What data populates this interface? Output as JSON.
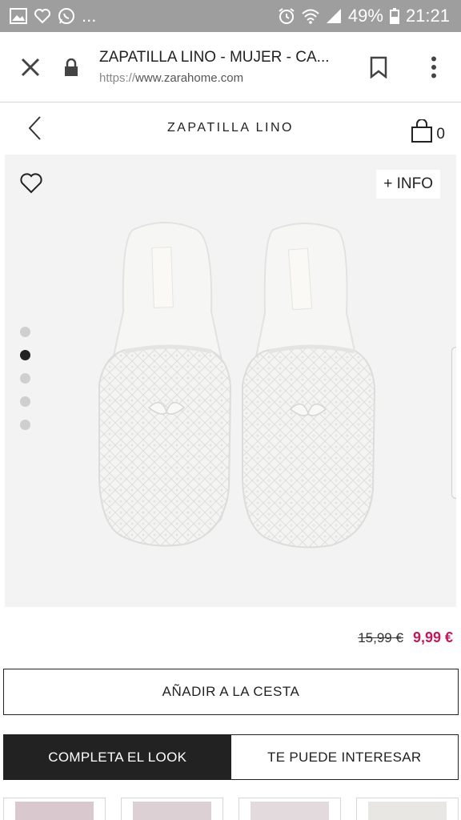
{
  "status_bar": {
    "dots": "...",
    "battery": "49%",
    "time": "21:21"
  },
  "browser": {
    "page_title": "ZAPATILLA LINO - MUJER - CA...",
    "url_protocol": "https://",
    "url_host": "www.zarahome.com"
  },
  "header": {
    "product_name": "ZAPATILLA LINO",
    "cart_count": "0"
  },
  "gallery": {
    "info_label": "+ INFO",
    "image_count": 5,
    "active_index": 1
  },
  "price": {
    "old": "15,99 €",
    "new": "9,99 €",
    "sale_color": "#c2185b"
  },
  "actions": {
    "add_to_cart": "AÑADIR A LA CESTA"
  },
  "tabs": [
    {
      "label": "COMPLETA EL LOOK",
      "active": true
    },
    {
      "label": "TE PUEDE INTERESAR",
      "active": false
    }
  ]
}
